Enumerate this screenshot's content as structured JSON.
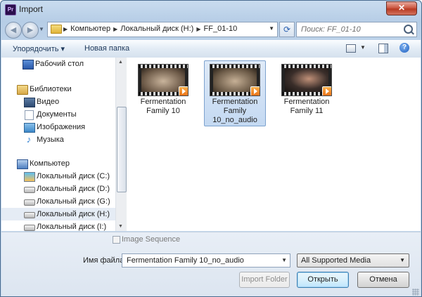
{
  "window": {
    "title": "Import",
    "app_icon_text": "Pr",
    "close_glyph": "✕"
  },
  "navbar": {
    "back_glyph": "◀",
    "forward_glyph": "▶",
    "breadcrumbs": [
      "Компьютер",
      "Локальный диск (H:)",
      "FF_01-10"
    ],
    "refresh_glyph": "⟳",
    "search_placeholder": "Поиск: FF_01-10"
  },
  "toolbar": {
    "organize_label": "Упорядочить ▾",
    "new_folder_label": "Новая папка",
    "help_glyph": "?"
  },
  "nav_pane": {
    "items": [
      {
        "label": "Рабочий стол",
        "icon": "desktop-icon"
      },
      {
        "label": "Библиотеки",
        "icon": "libraries-icon"
      },
      {
        "label": "Видео",
        "icon": "video-icon"
      },
      {
        "label": "Документы",
        "icon": "documents-icon"
      },
      {
        "label": "Изображения",
        "icon": "pictures-icon"
      },
      {
        "label": "Музыка",
        "icon": "music-icon"
      },
      {
        "label": "Компьютер",
        "icon": "computer-icon"
      },
      {
        "label": "Локальный диск (C:)",
        "icon": "drive-c-icon"
      },
      {
        "label": "Локальный диск (D:)",
        "icon": "drive-icon"
      },
      {
        "label": "Локальный диск (G:)",
        "icon": "drive-icon"
      },
      {
        "label": "Локальный диск (H:)",
        "icon": "drive-icon",
        "selected": true
      },
      {
        "label": "Локальный диск (I:)",
        "icon": "drive-icon"
      }
    ]
  },
  "files": [
    {
      "name": "Fermentation Family 10",
      "thumb_color": "#6d5a48"
    },
    {
      "name": "Fermentation Family 10_no_audio",
      "thumb_color": "#6a5946",
      "selected": true
    },
    {
      "name": "Fermentation Family 11",
      "thumb_color": "#3a2e2a"
    }
  ],
  "bottom": {
    "image_sequence_label": "Image Sequence",
    "filename_label": "Имя файла:",
    "filename_value": "Fermentation Family 10_no_audio",
    "filter_value": "All Supported Media",
    "import_folder_label": "Import Folder",
    "open_label": "Открыть",
    "cancel_label": "Отмена"
  }
}
